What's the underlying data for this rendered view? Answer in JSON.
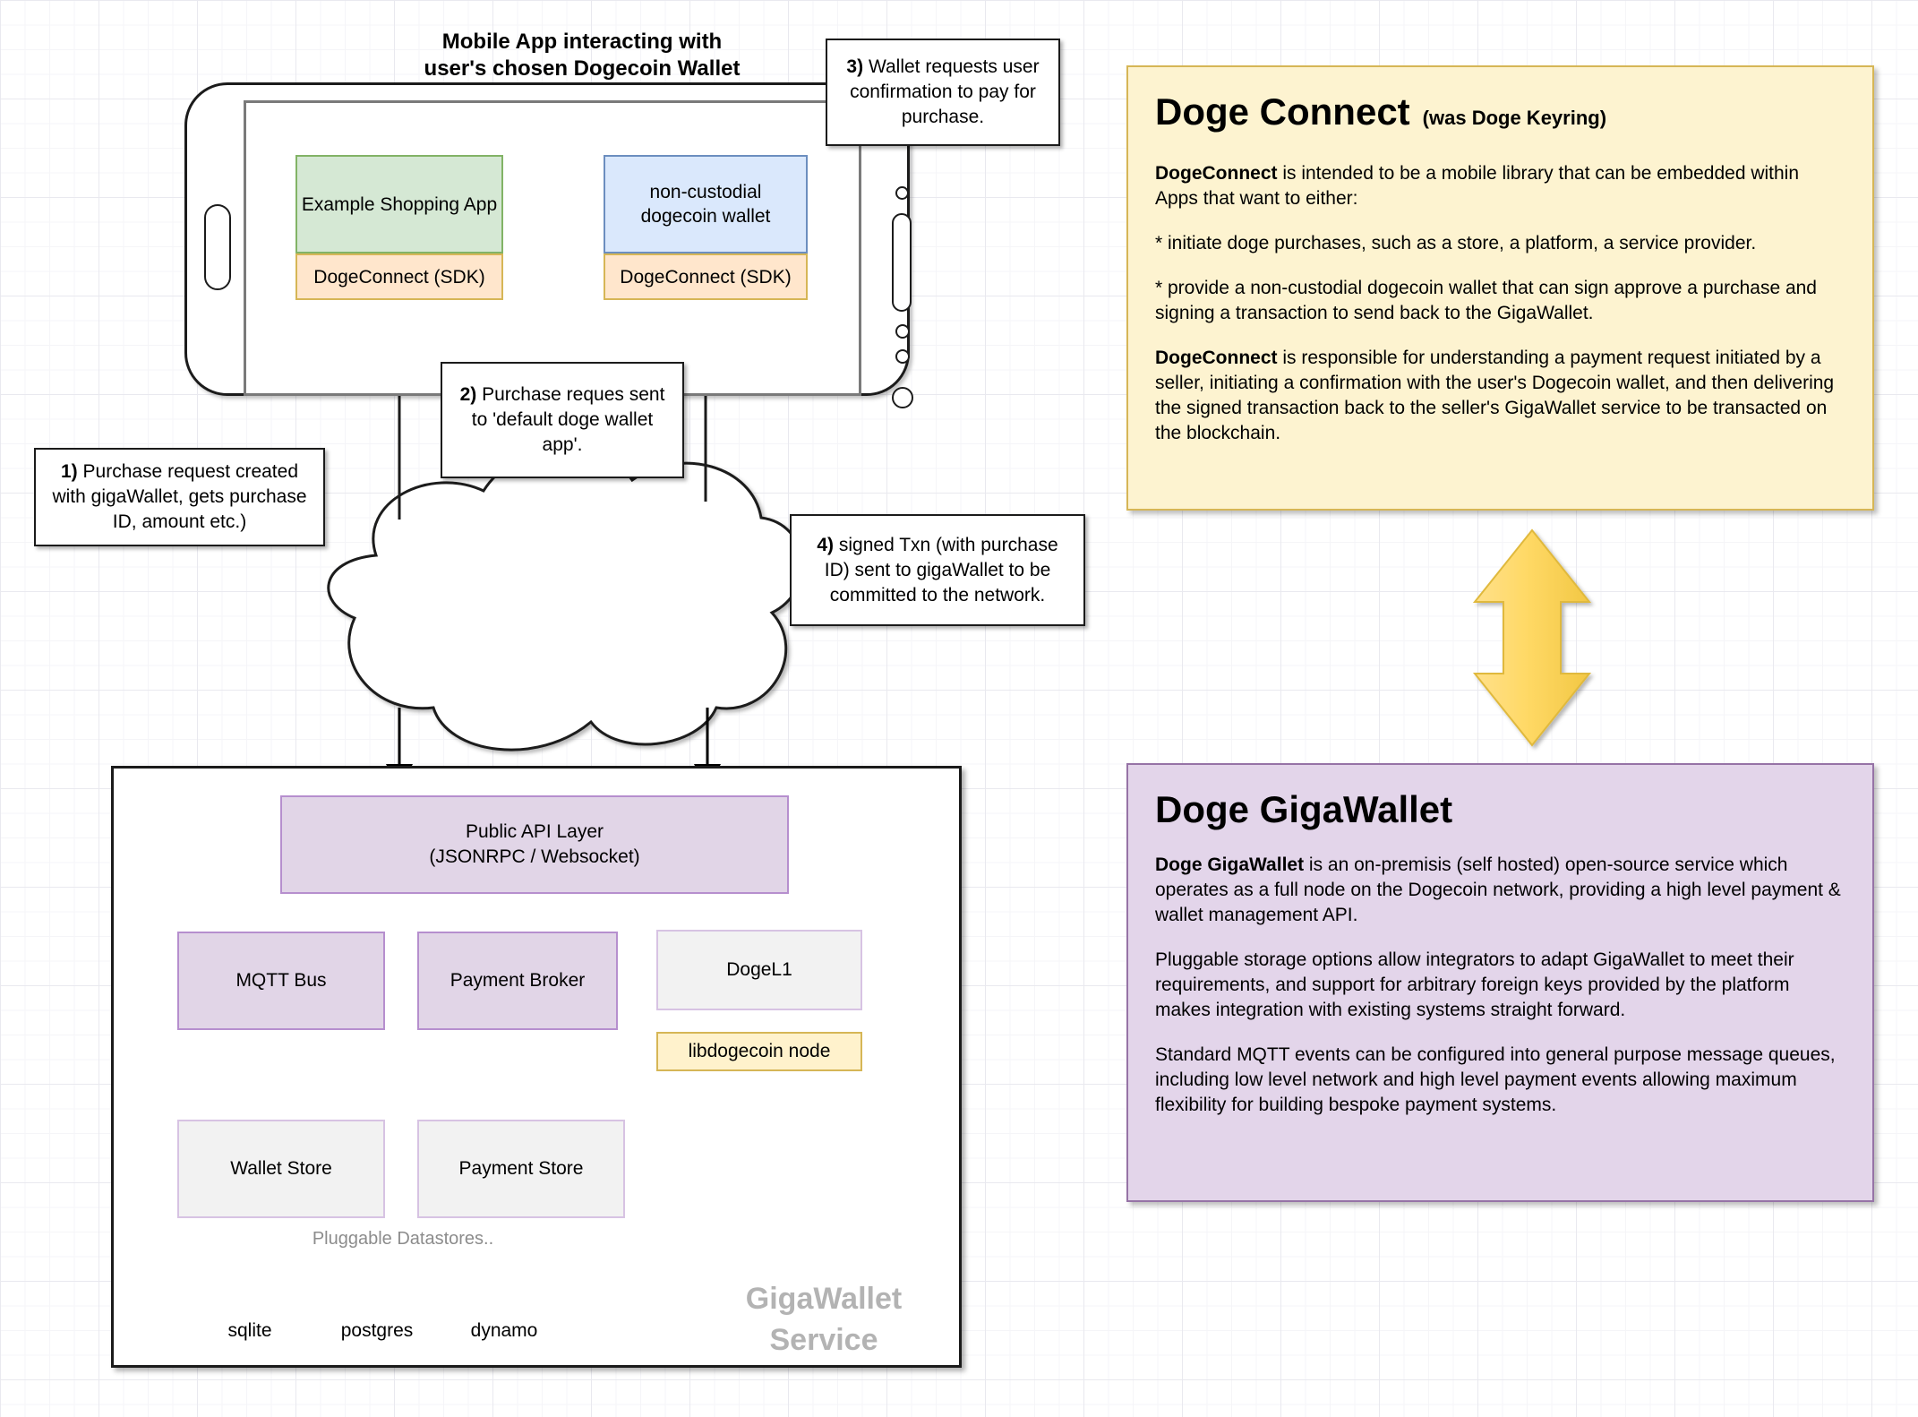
{
  "mobile": {
    "title_line1": "Mobile App interacting with",
    "title_line2": "user's chosen Dogecoin Wallet",
    "shopping_app_label": "Example Shopping App",
    "shopping_app_sdk_label": "DogeConnect (SDK)",
    "wallet_label_line1": "non-custodial",
    "wallet_label_line2": "dogecoin wallet",
    "wallet_sdk_label": "DogeConnect (SDK)"
  },
  "callouts": {
    "one_num": "1)",
    "one_text": " Purchase request created with gigaWallet, gets purchase ID, amount etc.)",
    "two_num": "2)",
    "two_text": " Purchase reques sent to 'default doge wallet app'.",
    "three_num": "3)",
    "three_text": " Wallet requests user confirmation to pay for purchase.",
    "four_num": "4)",
    "four_text": " signed Txn (with purchase ID) sent to gigaWallet to be committed to the network."
  },
  "service": {
    "watermark_line1": "GigaWallet",
    "watermark_line2": "Service",
    "api_layer_line1": "Public API Layer",
    "api_layer_line2": "(JSONRPC / Websocket)",
    "mqtt_bus": "MQTT Bus",
    "payment_broker": "Payment Broker",
    "dogel1": "DogeL1",
    "libdogecoin_node": "libdogecoin node",
    "wallet_store": "Wallet Store",
    "payment_store": "Payment Store",
    "pluggable_label": "Pluggable Datastores..",
    "datastores": [
      "sqlite",
      "postgres",
      "dynamo"
    ]
  },
  "doge_connect_panel": {
    "title": "Doge Connect",
    "subtitle": "(was Doge Keyring)",
    "p1_bold": "DogeConnect",
    "p1_rest": " is intended to be a mobile library that can be embedded within Apps that want to either:",
    "p2": "* initiate doge purchases, such as a store, a platform, a service provider.",
    "p3": "* provide a non-custodial dogecoin wallet that can sign approve a purchase and signing a transaction to send back to the GigaWallet.",
    "p4_bold": "DogeConnect",
    "p4_rest": " is responsible for understanding a payment request initiated by a seller, initiating a confirmation with the user's Dogecoin wallet, and then delivering the signed transaction back to the seller's GigaWallet service to be transacted on the blockchain."
  },
  "gigawallet_panel": {
    "title": "Doge GigaWallet",
    "p1_bold": "Doge GigaWallet",
    "p1_rest": " is an on-premisis (self hosted) open-source service which operates as a full node on the Dogecoin network, providing a high level payment & wallet management API.",
    "p2": "Pluggable storage options allow integrators to adapt GigaWallet to meet their requirements, and support for arbitrary foreign keys provided by the platform makes integration with existing systems straight forward.",
    "p3": "Standard MQTT events can be configured into general purpose message queues, including low level network and high level payment events allowing maximum flexibility for building bespoke payment systems."
  },
  "colors": {
    "green_fill": "#d5e8d4",
    "green_stroke": "#82b366",
    "blue_fill": "#dae8fc",
    "blue_stroke": "#6c8ebf",
    "yellow_fill": "#ffe6cc",
    "yellow_stroke": "#d6b656",
    "purple_fill": "#e1d5e7",
    "purple_stroke": "#9673a6",
    "panel_yellow": "#fdf3d0",
    "panel_purple": "#e3d5ea",
    "arrow_gold": "#ffd966",
    "cylinder_fill": "#dae8fc"
  }
}
